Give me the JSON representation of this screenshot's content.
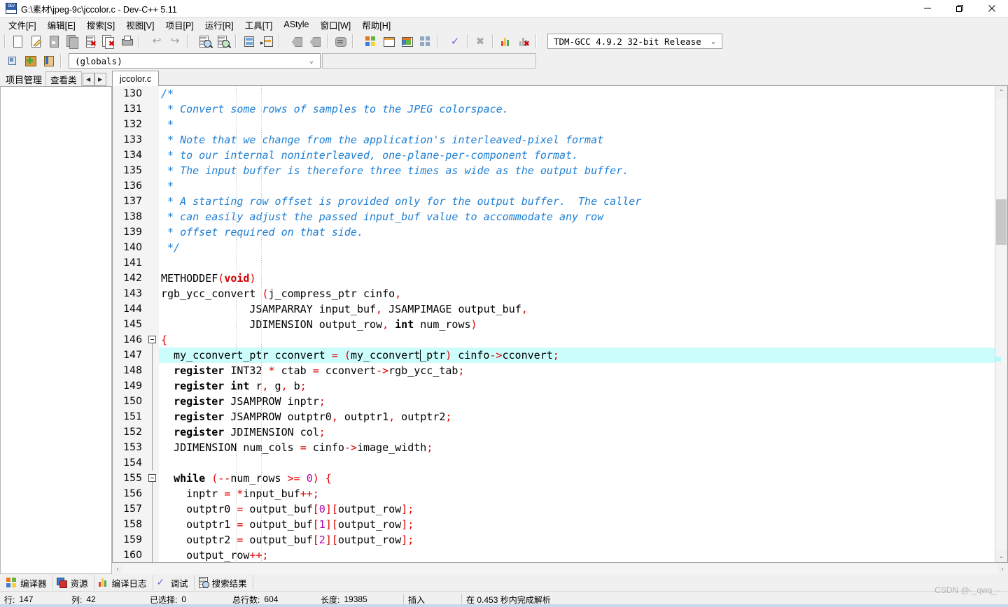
{
  "window": {
    "title": "G:\\素材\\jpeg-9c\\jccolor.c - Dev-C++ 5.11",
    "app_icon": "devcpp-icon",
    "minimize": "—",
    "maximize": "❐",
    "close": "✕"
  },
  "menubar": {
    "items": [
      {
        "label": "文件[F]",
        "name": "menu-file"
      },
      {
        "label": "编辑[E]",
        "name": "menu-edit"
      },
      {
        "label": "搜索[S]",
        "name": "menu-search"
      },
      {
        "label": "视图[V]",
        "name": "menu-view"
      },
      {
        "label": "项目[P]",
        "name": "menu-project"
      },
      {
        "label": "运行[R]",
        "name": "menu-run"
      },
      {
        "label": "工具[T]",
        "name": "menu-tools"
      },
      {
        "label": "AStyle",
        "name": "menu-astyle"
      },
      {
        "label": "窗口[W]",
        "name": "menu-window"
      },
      {
        "label": "帮助[H]",
        "name": "menu-help"
      }
    ]
  },
  "toolbar": {
    "icons": [
      "new-file-icon",
      "open-file-icon",
      "save-icon",
      "save-all-icon",
      "close-file-icon",
      "close-all-icon",
      "print-icon",
      "undo-icon",
      "redo-icon",
      "find-icon",
      "replace-icon",
      "goto-line-icon",
      "goto-function-icon",
      "previous-icon",
      "next-icon",
      "toggle-icon",
      "new-project-icon",
      "project-options-icon",
      "compile-icon",
      "rebuild-icon",
      "check-syntax-icon",
      "stop-icon",
      "profile-icon",
      "debug-stop-icon"
    ],
    "compiler_set": "TDM-GCC 4.9.2 32-bit Release"
  },
  "toolbar2": {
    "icons": [
      "goto-class-icon",
      "add-member-icon",
      "browse-icon"
    ],
    "scope_value": "(globals)"
  },
  "left_panel": {
    "tabs": [
      {
        "label": "项目管理",
        "name": "tab-project-manager",
        "active": true
      },
      {
        "label": "查看类",
        "name": "tab-class-browser",
        "active": false
      }
    ],
    "spinner": {
      "prev": "◀",
      "next": "▶"
    }
  },
  "editor": {
    "tabs": [
      {
        "label": "jccolor.c",
        "name": "tab-jccolor-c",
        "active": true
      }
    ],
    "highlight_line": 147,
    "fold_lines": [
      146,
      155
    ],
    "lines": [
      {
        "n": 130,
        "tokens": [
          {
            "t": "/*",
            "c": "cmt"
          }
        ]
      },
      {
        "n": 131,
        "tokens": [
          {
            "t": " * Convert some rows of samples to the JPEG colorspace.",
            "c": "cmt"
          }
        ]
      },
      {
        "n": 132,
        "tokens": [
          {
            "t": " *",
            "c": "cmt"
          }
        ]
      },
      {
        "n": 133,
        "tokens": [
          {
            "t": " * Note that we change from the application's interleaved-pixel format",
            "c": "cmt"
          }
        ]
      },
      {
        "n": 134,
        "tokens": [
          {
            "t": " * to our internal noninterleaved, one-plane-per-component format.",
            "c": "cmt"
          }
        ]
      },
      {
        "n": 135,
        "tokens": [
          {
            "t": " * The input buffer is therefore three times as wide as the output buffer.",
            "c": "cmt"
          }
        ]
      },
      {
        "n": 136,
        "tokens": [
          {
            "t": " *",
            "c": "cmt"
          }
        ]
      },
      {
        "n": 137,
        "tokens": [
          {
            "t": " * A starting row offset is provided only for the output buffer.  The caller",
            "c": "cmt"
          }
        ]
      },
      {
        "n": 138,
        "tokens": [
          {
            "t": " * can easily adjust the passed input_buf value to accommodate any row",
            "c": "cmt"
          }
        ]
      },
      {
        "n": 139,
        "tokens": [
          {
            "t": " * offset required on that side.",
            "c": "cmt"
          }
        ]
      },
      {
        "n": 140,
        "tokens": [
          {
            "t": " */",
            "c": "cmt"
          }
        ]
      },
      {
        "n": 141,
        "tokens": []
      },
      {
        "n": 142,
        "tokens": [
          {
            "t": "METHODDEF",
            "c": "idf"
          },
          {
            "t": "(",
            "c": "op"
          },
          {
            "t": "void",
            "c": "kwr"
          },
          {
            "t": ")",
            "c": "op"
          }
        ]
      },
      {
        "n": 143,
        "tokens": [
          {
            "t": "rgb_ycc_convert ",
            "c": "idf"
          },
          {
            "t": "(",
            "c": "op"
          },
          {
            "t": "j_compress_ptr cinfo",
            "c": "idf"
          },
          {
            "t": ",",
            "c": "op"
          }
        ]
      },
      {
        "n": 144,
        "tokens": [
          {
            "t": "              JSAMPARRAY input_buf",
            "c": "idf"
          },
          {
            "t": ",",
            "c": "op"
          },
          {
            "t": " JSAMPIMAGE output_buf",
            "c": "idf"
          },
          {
            "t": ",",
            "c": "op"
          }
        ]
      },
      {
        "n": 145,
        "tokens": [
          {
            "t": "              JDIMENSION output_row",
            "c": "idf"
          },
          {
            "t": ",",
            "c": "op"
          },
          {
            "t": " ",
            "c": "idf"
          },
          {
            "t": "int",
            "c": "kw"
          },
          {
            "t": " num_rows",
            "c": "idf"
          },
          {
            "t": ")",
            "c": "op"
          }
        ]
      },
      {
        "n": 146,
        "tokens": [
          {
            "t": "{",
            "c": "op"
          }
        ]
      },
      {
        "n": 147,
        "tokens": [
          {
            "t": "  my_cconvert_ptr cconvert ",
            "c": "idf"
          },
          {
            "t": "=",
            "c": "op"
          },
          {
            "t": " ",
            "c": "idf"
          },
          {
            "t": "(",
            "c": "op"
          },
          {
            "t": "my_cconvert",
            "c": "idf"
          },
          {
            "t": "|CARET|",
            "c": "caret"
          },
          {
            "t": "_ptr",
            "c": "idf"
          },
          {
            "t": ")",
            "c": "op"
          },
          {
            "t": " cinfo",
            "c": "idf"
          },
          {
            "t": "->",
            "c": "op"
          },
          {
            "t": "cconvert",
            "c": "idf"
          },
          {
            "t": ";",
            "c": "op"
          }
        ]
      },
      {
        "n": 148,
        "tokens": [
          {
            "t": "  ",
            "c": "idf"
          },
          {
            "t": "register",
            "c": "kw"
          },
          {
            "t": " INT32 ",
            "c": "idf"
          },
          {
            "t": "*",
            "c": "op"
          },
          {
            "t": " ctab ",
            "c": "idf"
          },
          {
            "t": "=",
            "c": "op"
          },
          {
            "t": " cconvert",
            "c": "idf"
          },
          {
            "t": "->",
            "c": "op"
          },
          {
            "t": "rgb_ycc_tab",
            "c": "idf"
          },
          {
            "t": ";",
            "c": "op"
          }
        ]
      },
      {
        "n": 149,
        "tokens": [
          {
            "t": "  ",
            "c": "idf"
          },
          {
            "t": "register",
            "c": "kw"
          },
          {
            "t": " ",
            "c": "idf"
          },
          {
            "t": "int",
            "c": "kw"
          },
          {
            "t": " r",
            "c": "idf"
          },
          {
            "t": ",",
            "c": "op"
          },
          {
            "t": " g",
            "c": "idf"
          },
          {
            "t": ",",
            "c": "op"
          },
          {
            "t": " b",
            "c": "idf"
          },
          {
            "t": ";",
            "c": "op"
          }
        ]
      },
      {
        "n": 150,
        "tokens": [
          {
            "t": "  ",
            "c": "idf"
          },
          {
            "t": "register",
            "c": "kw"
          },
          {
            "t": " JSAMPROW inptr",
            "c": "idf"
          },
          {
            "t": ";",
            "c": "op"
          }
        ]
      },
      {
        "n": 151,
        "tokens": [
          {
            "t": "  ",
            "c": "idf"
          },
          {
            "t": "register",
            "c": "kw"
          },
          {
            "t": " JSAMPROW outptr0",
            "c": "idf"
          },
          {
            "t": ",",
            "c": "op"
          },
          {
            "t": " outptr1",
            "c": "idf"
          },
          {
            "t": ",",
            "c": "op"
          },
          {
            "t": " outptr2",
            "c": "idf"
          },
          {
            "t": ";",
            "c": "op"
          }
        ]
      },
      {
        "n": 152,
        "tokens": [
          {
            "t": "  ",
            "c": "idf"
          },
          {
            "t": "register",
            "c": "kw"
          },
          {
            "t": " JDIMENSION col",
            "c": "idf"
          },
          {
            "t": ";",
            "c": "op"
          }
        ]
      },
      {
        "n": 153,
        "tokens": [
          {
            "t": "  JDIMENSION num_cols ",
            "c": "idf"
          },
          {
            "t": "=",
            "c": "op"
          },
          {
            "t": " cinfo",
            "c": "idf"
          },
          {
            "t": "->",
            "c": "op"
          },
          {
            "t": "image_width",
            "c": "idf"
          },
          {
            "t": ";",
            "c": "op"
          }
        ]
      },
      {
        "n": 154,
        "tokens": []
      },
      {
        "n": 155,
        "tokens": [
          {
            "t": "  ",
            "c": "idf"
          },
          {
            "t": "while",
            "c": "kw"
          },
          {
            "t": " ",
            "c": "idf"
          },
          {
            "t": "(--",
            "c": "op"
          },
          {
            "t": "num_rows ",
            "c": "idf"
          },
          {
            "t": ">=",
            "c": "op"
          },
          {
            "t": " ",
            "c": "idf"
          },
          {
            "t": "0",
            "c": "num"
          },
          {
            "t": ") {",
            "c": "op"
          }
        ]
      },
      {
        "n": 156,
        "tokens": [
          {
            "t": "    inptr ",
            "c": "idf"
          },
          {
            "t": "=",
            "c": "op"
          },
          {
            "t": " ",
            "c": "idf"
          },
          {
            "t": "*",
            "c": "op"
          },
          {
            "t": "input_buf",
            "c": "idf"
          },
          {
            "t": "++;",
            "c": "op"
          }
        ]
      },
      {
        "n": 157,
        "tokens": [
          {
            "t": "    outptr0 ",
            "c": "idf"
          },
          {
            "t": "=",
            "c": "op"
          },
          {
            "t": " output_buf",
            "c": "idf"
          },
          {
            "t": "[",
            "c": "op"
          },
          {
            "t": "0",
            "c": "num"
          },
          {
            "t": "][",
            "c": "op"
          },
          {
            "t": "output_row",
            "c": "idf"
          },
          {
            "t": "];",
            "c": "op"
          }
        ]
      },
      {
        "n": 158,
        "tokens": [
          {
            "t": "    outptr1 ",
            "c": "idf"
          },
          {
            "t": "=",
            "c": "op"
          },
          {
            "t": " output_buf",
            "c": "idf"
          },
          {
            "t": "[",
            "c": "op"
          },
          {
            "t": "1",
            "c": "num"
          },
          {
            "t": "][",
            "c": "op"
          },
          {
            "t": "output_row",
            "c": "idf"
          },
          {
            "t": "];",
            "c": "op"
          }
        ]
      },
      {
        "n": 159,
        "tokens": [
          {
            "t": "    outptr2 ",
            "c": "idf"
          },
          {
            "t": "=",
            "c": "op"
          },
          {
            "t": " output_buf",
            "c": "idf"
          },
          {
            "t": "[",
            "c": "op"
          },
          {
            "t": "2",
            "c": "num"
          },
          {
            "t": "][",
            "c": "op"
          },
          {
            "t": "output_row",
            "c": "idf"
          },
          {
            "t": "];",
            "c": "op"
          }
        ]
      },
      {
        "n": 160,
        "tokens": [
          {
            "t": "    output_row",
            "c": "idf"
          },
          {
            "t": "++;",
            "c": "op"
          }
        ]
      }
    ]
  },
  "bottom_tabs": [
    {
      "label": "编译器",
      "name": "bottom-tab-compiler",
      "icon": "compiler-icon"
    },
    {
      "label": "资源",
      "name": "bottom-tab-resources",
      "icon": "resources-icon"
    },
    {
      "label": "编译日志",
      "name": "bottom-tab-compile-log",
      "icon": "log-icon"
    },
    {
      "label": "调试",
      "name": "bottom-tab-debug",
      "icon": "debug-icon"
    },
    {
      "label": "搜索结果",
      "name": "bottom-tab-find-results",
      "icon": "find-results-icon"
    }
  ],
  "statusbar": {
    "row_label": "行:",
    "row_value": "147",
    "col_label": "列:",
    "col_value": "42",
    "sel_label": "已选择:",
    "sel_value": "0",
    "total_label": "总行数:",
    "total_value": "604",
    "len_label": "长度:",
    "len_value": "19385",
    "insert_mode": "插入",
    "parse_message": "在 0.453 秒内完成解析"
  },
  "watermark": "CSDN @-_qwq_-"
}
